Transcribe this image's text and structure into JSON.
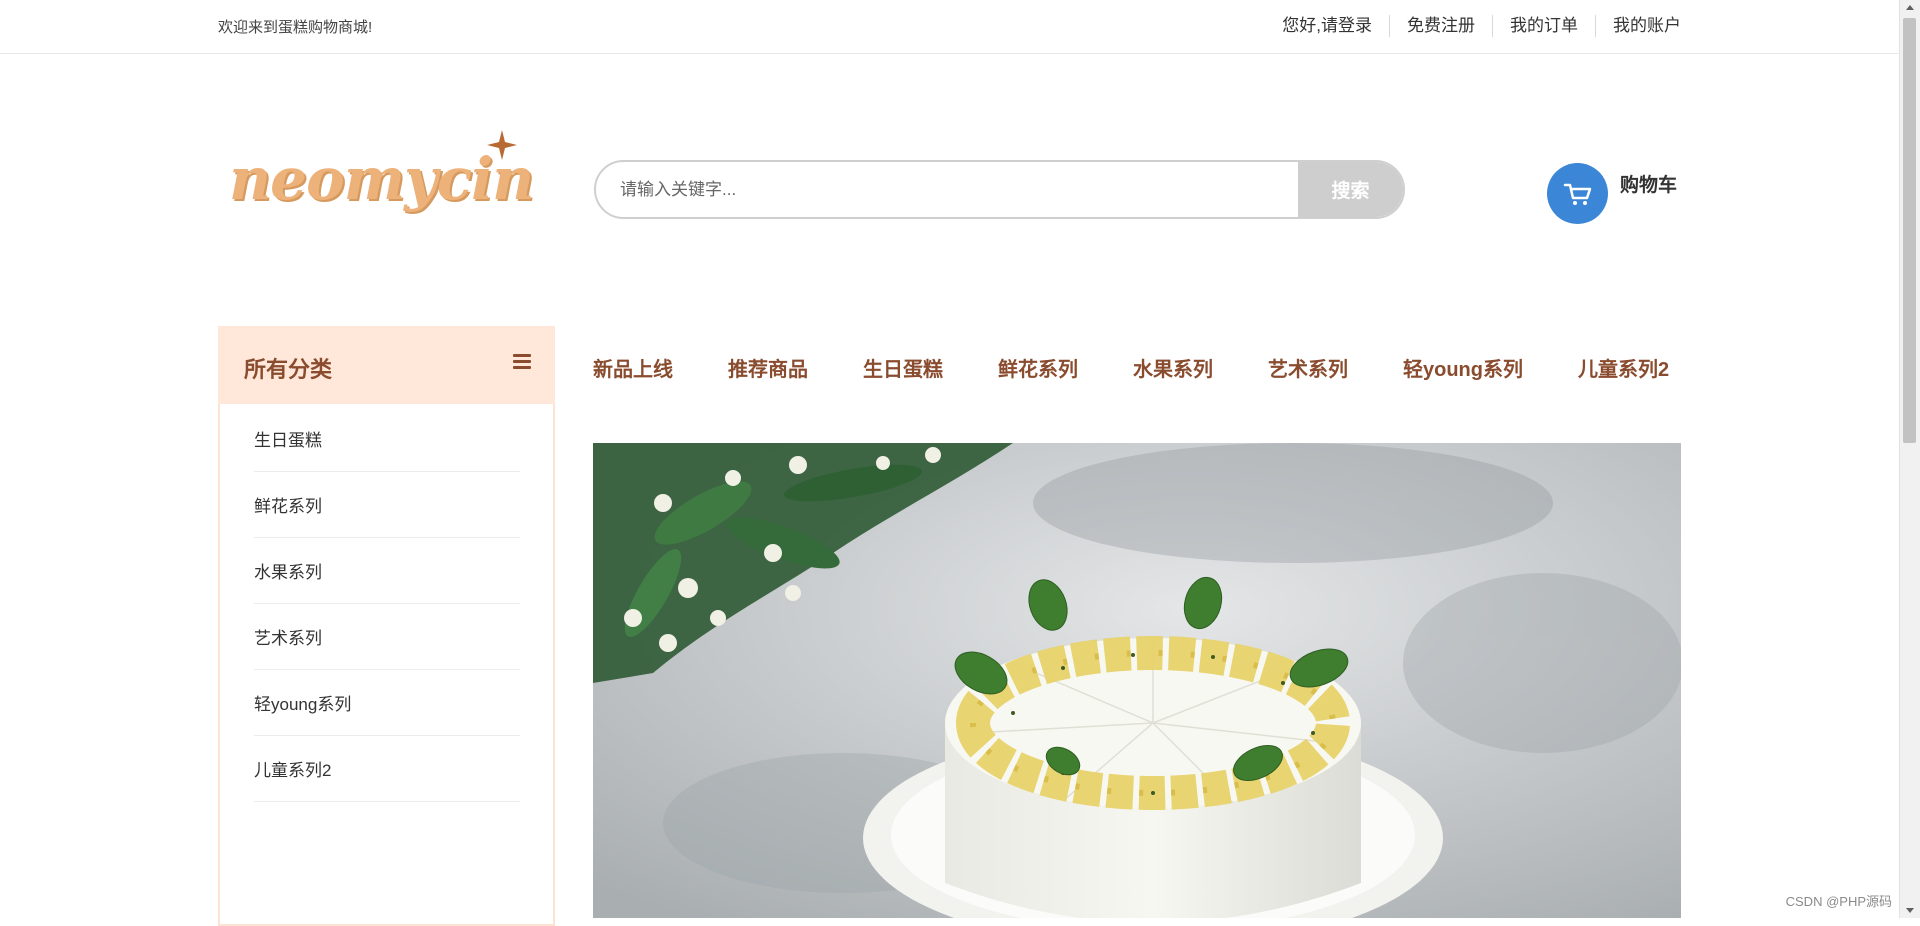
{
  "topbar": {
    "welcome": "欢迎来到蛋糕购物商城!",
    "links": [
      "您好,请登录",
      "免费注册",
      "我的订单",
      "我的账户"
    ]
  },
  "header": {
    "logo_text": "neomycin",
    "search": {
      "placeholder": "请输入关键字...",
      "button": "搜索"
    },
    "cart": {
      "label": "购物车"
    }
  },
  "sidebar": {
    "title": "所有分类",
    "items": [
      "生日蛋糕",
      "鲜花系列",
      "水果系列",
      "艺术系列",
      "轻young系列",
      "儿童系列2"
    ]
  },
  "nav": {
    "items": [
      "新品上线",
      "推荐商品",
      "生日蛋糕",
      "鲜花系列",
      "水果系列",
      "艺术系列",
      "轻young系列",
      "儿童系列2"
    ]
  },
  "watermark": "CSDN @PHP源码",
  "colors": {
    "accent_brown": "#8a4c2f",
    "sidebar_header_bg": "#ffe8da",
    "cart_blue": "#3b86d6",
    "logo_orange": "#edb27a",
    "search_button": "#cecece"
  }
}
